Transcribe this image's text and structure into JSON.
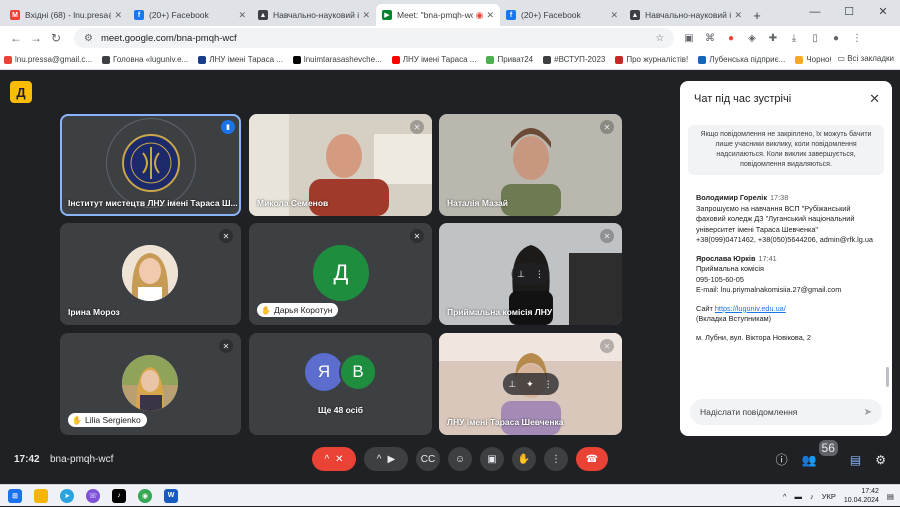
{
  "tabs": [
    {
      "title": "Вхідні (68) - lnu.presa@...",
      "favicon": "gmail-icon",
      "color": "#ea4335",
      "active": false
    },
    {
      "title": "(20+) Facebook",
      "favicon": "facebook-icon",
      "color": "#1877f2",
      "active": false
    },
    {
      "title": "Навчально-науковий інс...",
      "favicon": "graduation-cap-icon",
      "color": "#3c4043",
      "active": false
    },
    {
      "title": "Meet: \"bna-pmqh-wcf\"",
      "favicon": "meet-icon",
      "color": "#00832d",
      "active": true
    },
    {
      "title": "(20+) Facebook",
      "favicon": "facebook-icon",
      "color": "#1877f2",
      "active": false
    },
    {
      "title": "Навчально-науковий інс...",
      "favicon": "graduation-cap-icon",
      "color": "#3c4043",
      "active": false
    }
  ],
  "window": {
    "new_tab": "+",
    "minimize": "—",
    "maximize": "☐",
    "close": "✕"
  },
  "address": {
    "url": "meet.google.com/bna-pmqh-wcf"
  },
  "bookmarks": [
    {
      "label": "lnu.pressa@gmail.c...",
      "color": "#ea4335"
    },
    {
      "label": "Головна «luguniv.e...",
      "color": "#3c4043"
    },
    {
      "label": "ЛНУ імені Тараса ...",
      "color": "#1a3c8c"
    },
    {
      "label": "lnuimtarasashevche...",
      "color": "#000000"
    },
    {
      "label": "ЛНУ імені Тараса ...",
      "color": "#ff0000"
    },
    {
      "label": "Приват24",
      "color": "#4caf50"
    },
    {
      "label": "#ВСТУП-2023",
      "color": "#3c4043"
    },
    {
      "label": "Про журналістів!",
      "color": "#c62828"
    },
    {
      "label": "Лубенська підприє...",
      "color": "#1565c0"
    },
    {
      "label": "Чорнобильці",
      "color": "#f9a825"
    }
  ],
  "bookmarks_all": "Всі закладки",
  "meet": {
    "logo_letter": "Д",
    "time": "17:42",
    "code": "bna-pmqh-wcf",
    "participants_count": "56"
  },
  "tiles": [
    {
      "name": "Інститут мистецтв ЛНУ імені Тараса Ш...",
      "avatar": "emblem",
      "speaking": true
    },
    {
      "name": "Микола Семенов",
      "avatar": "video-man",
      "speaking": false
    },
    {
      "name": "Наталія Мазай",
      "avatar": "video-woman",
      "speaking": false
    },
    {
      "name": "Ірина Мороз",
      "avatar": "photo-woman",
      "speaking": false
    },
    {
      "name": "Дарья Коротун",
      "avatar_letter": "Д",
      "avatar_color": "#1e8e3e",
      "speaking": false
    },
    {
      "name": "Приймальна комісія ЛНУ",
      "avatar": "video-room",
      "speaking": false
    },
    {
      "name": "Lilia Sergienko",
      "avatar": "photo-woman",
      "speaking": false
    },
    {
      "name": "Ще 48 осіб",
      "avatar_letter": "Я",
      "avatar_letter2": "В",
      "avatar_color": "#5b6dcd",
      "avatar_color2": "#1e8e3e",
      "speaking": false
    },
    {
      "name": "ЛНУ імені Тараса Шевченка",
      "avatar": "video-room2",
      "speaking": false
    }
  ],
  "chat": {
    "title": "Чат під час зустрічі",
    "note": "Якщо повідомлення не закріплено, їх можуть бачити лише учасники виклику, коли повідомлення надсилаються. Коли виклик завершується, повідомлення видаляються.",
    "messages": [
      {
        "sender": "Володимир Горелік",
        "time": "17:38",
        "lines": [
          "Запрошуємо на навчання ВСП \"Рубіжанський фаховий коледж ДЗ \"Луганський національний університет імені Тараса Шевченка\"",
          "+38(099)0471462, +38(050)5644206, admin@rfk.lg.ua"
        ]
      },
      {
        "sender": "Ярослава Юрків",
        "time": "17:41",
        "lines": [
          "Приймальна комісія",
          "095-105-60-05",
          "E-mail: lnu.priymalnakomisiia.27@gmail.com"
        ]
      }
    ],
    "site_prefix": "Сайт",
    "site_link": "https://luguniv.edu.ua/",
    "site_note": "(Вкладка Вступникам)",
    "address": "м. Лубни, вул. Віктора Новікова, 2",
    "input_placeholder": "Надіслати повідомлення"
  },
  "taskbar": {
    "lang": "УКР",
    "time": "17:42",
    "date": "10.04.2024"
  }
}
